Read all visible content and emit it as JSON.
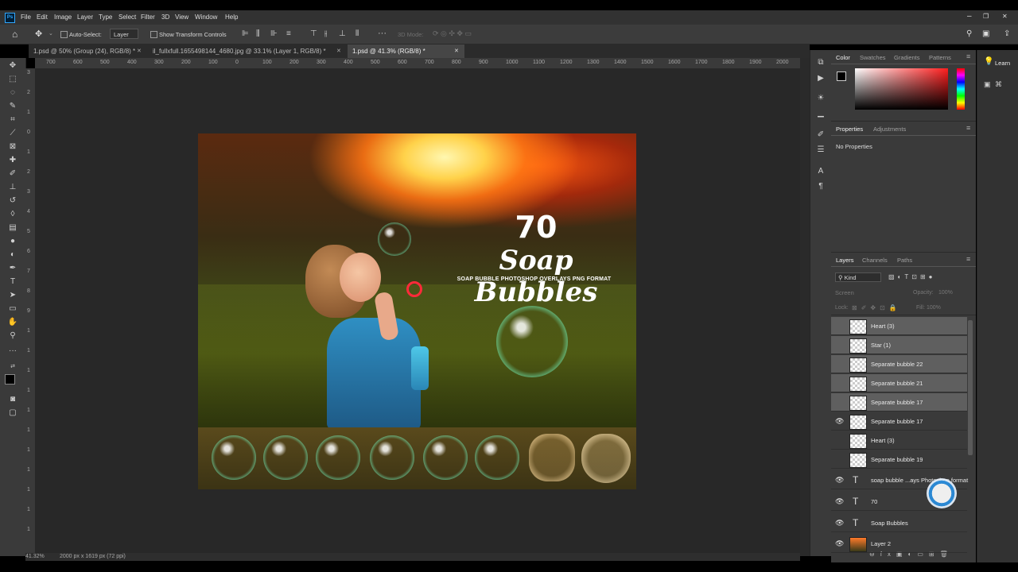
{
  "app": {
    "logo": "Ps"
  },
  "menu": [
    "File",
    "Edit",
    "Image",
    "Layer",
    "Type",
    "Select",
    "Filter",
    "3D",
    "View",
    "Window",
    "Help"
  ],
  "options": {
    "auto_select_label": "Auto-Select:",
    "auto_select_value": "Layer",
    "show_transform_label": "Show Transform Controls",
    "mode_3d_label": "3D Mode:"
  },
  "tabs": [
    {
      "label": "1.psd @ 50% (Group (24), RGB/8) *"
    },
    {
      "label": "il_fullxfull.1655498144_4680.jpg @ 33.1% (Layer 1, RGB/8) *"
    },
    {
      "label": "1.psd @ 41.3% (RGB/8) *"
    }
  ],
  "ruler_h": [
    "700",
    "600",
    "500",
    "400",
    "300",
    "200",
    "100",
    "0",
    "100",
    "200",
    "300",
    "400",
    "500",
    "600",
    "700",
    "800",
    "900",
    "1000",
    "1100",
    "1200",
    "1300",
    "1400",
    "1500",
    "1600",
    "1700",
    "1800",
    "1900",
    "2000",
    "2100",
    "2200",
    "2300",
    "2400",
    "2500",
    "2600",
    "2700"
  ],
  "ruler_v": [
    "3",
    "2",
    "1",
    "0",
    "1",
    "2",
    "3",
    "4",
    "5",
    "6",
    "7",
    "8",
    "9",
    "1",
    "1",
    "1",
    "1",
    "1",
    "1",
    "1",
    "1",
    "1",
    "1",
    "1"
  ],
  "artwork": {
    "number": "70",
    "title": "Soap Bubbles",
    "subtitle": "SOAP BUBBLE PHOTOSHOP OVERLAYS PNG FORMAT"
  },
  "status": {
    "zoom": "41.32%",
    "doc_size": "2000 px x 1619 px (72 ppi)"
  },
  "color_panel": {
    "tabs": [
      "Color",
      "Swatches",
      "Gradients",
      "Patterns"
    ]
  },
  "properties_panel": {
    "tabs": [
      "Properties",
      "Adjustments"
    ],
    "content": "No Properties"
  },
  "layers_panel": {
    "tabs": [
      "Layers",
      "Channels",
      "Paths"
    ],
    "filter_label": "Kind",
    "blend_mode": "Screen",
    "opacity_label": "Opacity:",
    "opacity_value": "100%",
    "lock_label": "Lock:",
    "fill_label": "Fill:",
    "fill_value": "100%",
    "layers": [
      {
        "name": "Heart (3)",
        "type": "smart",
        "visible": false,
        "selected": true
      },
      {
        "name": "Star (1)",
        "type": "smart",
        "visible": false,
        "selected": true
      },
      {
        "name": "Separate bubble 22",
        "type": "smart",
        "visible": false,
        "selected": true
      },
      {
        "name": "Separate bubble 21",
        "type": "smart",
        "visible": false,
        "selected": true
      },
      {
        "name": "Separate bubble 17",
        "type": "smart",
        "visible": false,
        "selected": true
      },
      {
        "name": "Separate bubble 17",
        "type": "smart",
        "visible": true,
        "selected": false
      },
      {
        "name": "Heart (3)",
        "type": "smart",
        "visible": false,
        "selected": false
      },
      {
        "name": "Separate bubble 19",
        "type": "smart",
        "visible": false,
        "selected": false
      },
      {
        "name": "soap bubble ...ays Photoshop format",
        "type": "text",
        "visible": true,
        "selected": false
      },
      {
        "name": "70",
        "type": "text",
        "visible": true,
        "selected": false
      },
      {
        "name": "Soap Bubbles",
        "type": "text",
        "visible": true,
        "selected": false
      },
      {
        "name": "Layer 2",
        "type": "image",
        "visible": true,
        "selected": false
      }
    ]
  },
  "learn": {
    "label": "Learn"
  },
  "colors": {
    "foreground": "#000000",
    "background": "#ffffff",
    "selected_layer": "#5f5f5f",
    "panel": "#3a3a3a"
  }
}
